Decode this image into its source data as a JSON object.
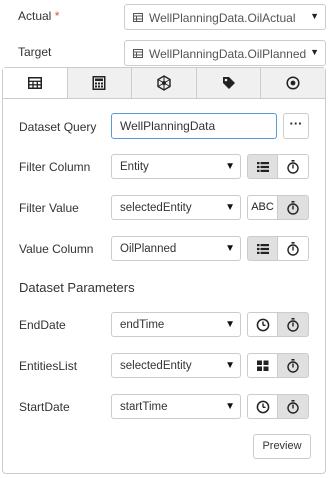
{
  "top_fields": [
    {
      "label": "Actual",
      "required_mark": "*",
      "value": "WellPlanningData.OilActual"
    },
    {
      "label": "Target",
      "value": "WellPlanningData.OilPlanned"
    }
  ],
  "tabs": [
    {
      "icon": "table-icon",
      "active": true
    },
    {
      "icon": "calculator-icon",
      "active": false
    },
    {
      "icon": "hexagon-network-icon",
      "active": false
    },
    {
      "icon": "tag-icon",
      "active": false
    },
    {
      "icon": "target-circle-icon",
      "active": false
    }
  ],
  "dataset_query": {
    "label": "Dataset Query",
    "value": "WellPlanningData",
    "more_label": "···"
  },
  "filter_column": {
    "label": "Filter Column",
    "value": "Entity",
    "toggle": [
      "list-icon",
      "timer-icon"
    ],
    "active_toggle": "list-icon"
  },
  "filter_value": {
    "label": "Filter Value",
    "value": "selectedEntity",
    "toggle_text": "ABC",
    "active_toggle": "timer-icon"
  },
  "value_column": {
    "label": "Value Column",
    "value": "OilPlanned",
    "active_toggle": "list-icon"
  },
  "parameters_title": "Dataset Parameters",
  "parameters": [
    {
      "label": "EndDate",
      "value": "endTime",
      "left_icon": "clock-icon",
      "active_toggle": "timer-icon"
    },
    {
      "label": "EntitiesList",
      "value": "selectedEntity",
      "left_icon": "grid-icon",
      "active_toggle": "timer-icon"
    },
    {
      "label": "StartDate",
      "value": "startTime",
      "left_icon": "clock-icon",
      "active_toggle": "timer-icon"
    }
  ],
  "preview_label": "Preview",
  "caret": "▼",
  "colors": {
    "border": "#cccccc",
    "focus": "#5b9bd5",
    "tab_bg": "#f0f0f0",
    "active_toggle_bg": "#e0e0e0",
    "required": "#d9534f"
  }
}
